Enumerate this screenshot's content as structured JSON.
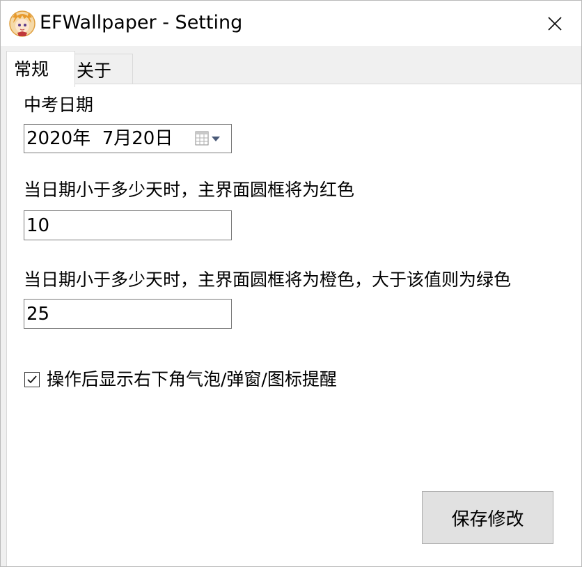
{
  "window": {
    "title": "EFWallpaper - Setting",
    "icons": {
      "app": "app-logo-icon",
      "close": "close-icon"
    }
  },
  "tabs": [
    {
      "label": "常规",
      "active": true
    },
    {
      "label": "关于",
      "active": false
    }
  ],
  "general": {
    "exam_date_label": "中考日期",
    "exam_date_value": "2020年  7月20日",
    "red_threshold_label": "当日期小于多少天时，主界面圆框将为红色",
    "red_threshold_value": "10",
    "orange_threshold_label": "当日期小于多少天时，主界面圆框将为橙色，大于该值则为绿色",
    "orange_threshold_value": "25",
    "notify_checkbox_label": "操作后显示右下角气泡/弹窗/图标提醒",
    "notify_checked": true,
    "save_button_label": "保存修改"
  },
  "colors": {
    "window_bg": "#f0f0f0",
    "panel_bg": "#ffffff",
    "button_bg": "#e1e1e1",
    "field_border": "#7a7a7a"
  }
}
